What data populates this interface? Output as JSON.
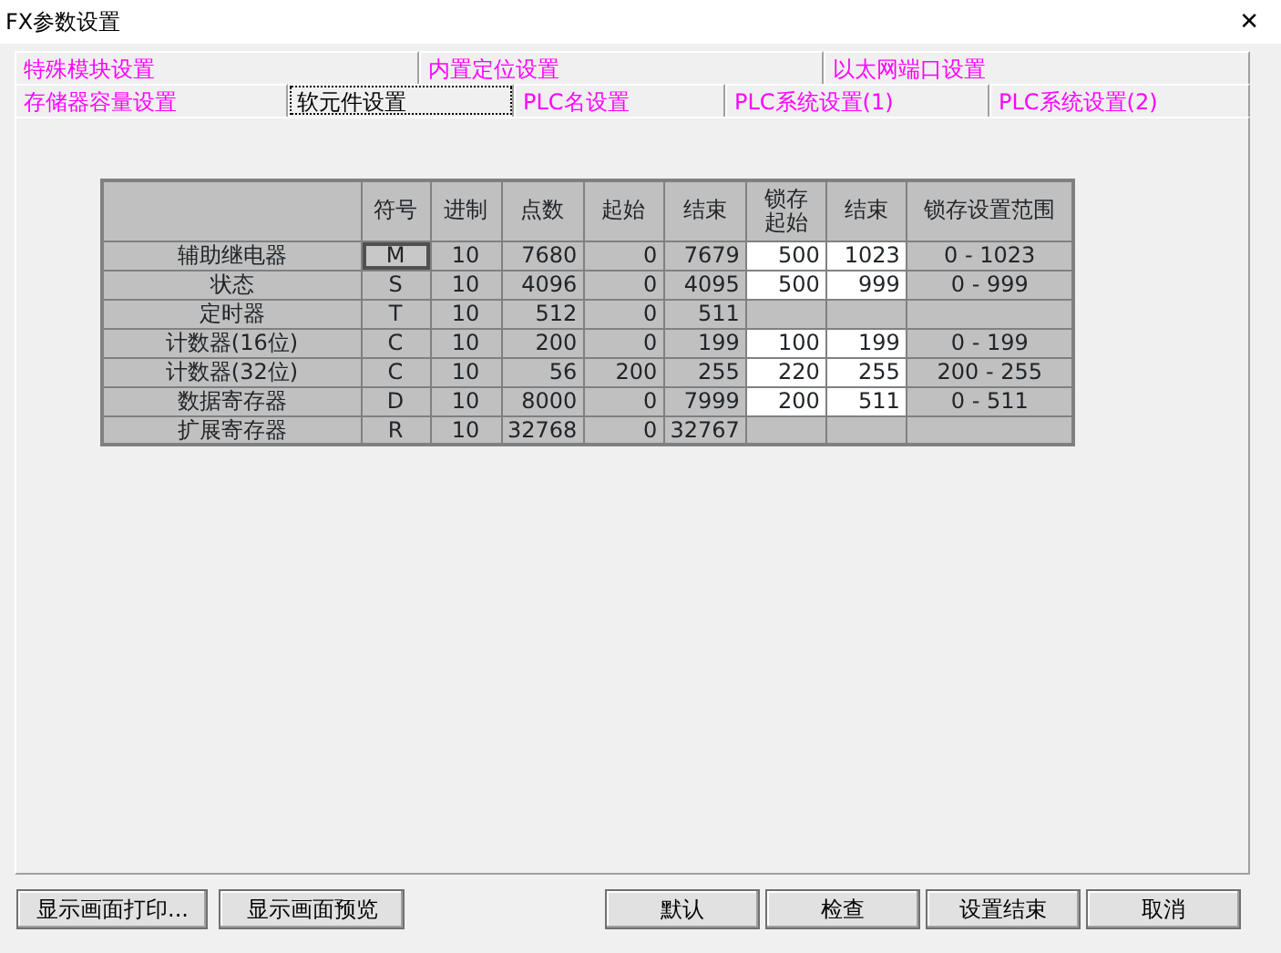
{
  "window": {
    "title": "FX参数设置",
    "close": "✕"
  },
  "tab_rows": [
    [
      {
        "label": "特殊模块设置",
        "selected": false
      },
      {
        "label": "内置定位设置",
        "selected": false
      },
      {
        "label": "以太网端口设置",
        "selected": false
      }
    ],
    [
      {
        "label": "存储器容量设置",
        "selected": false
      },
      {
        "label": "软元件设置",
        "selected": true
      },
      {
        "label": "PLC名设置",
        "selected": false
      },
      {
        "label": "PLC系统设置(1)",
        "selected": false
      },
      {
        "label": "PLC系统设置(2)",
        "selected": false
      }
    ]
  ],
  "table": {
    "columns": [
      "符号",
      "进制",
      "点数",
      "起始",
      "结束",
      "锁存起始",
      "结束",
      "锁存设置范围"
    ],
    "rows": [
      {
        "name": "辅助继电器",
        "symbol": "M",
        "selected": true,
        "base": "10",
        "points": "7680",
        "start": "0",
        "end": "7679",
        "latch_start": "500",
        "latch_end": "1023",
        "latch_range": "0 - 1023"
      },
      {
        "name": "状态",
        "symbol": "S",
        "selected": false,
        "base": "10",
        "points": "4096",
        "start": "0",
        "end": "4095",
        "latch_start": "500",
        "latch_end": "999",
        "latch_range": "0 - 999"
      },
      {
        "name": "定时器",
        "symbol": "T",
        "selected": false,
        "base": "10",
        "points": "512",
        "start": "0",
        "end": "511"
      },
      {
        "name": "计数器(16位)",
        "symbol": "C",
        "selected": false,
        "base": "10",
        "points": "200",
        "start": "0",
        "end": "199",
        "latch_start": "100",
        "latch_end": "199",
        "latch_range": "0 - 199"
      },
      {
        "name": "计数器(32位)",
        "symbol": "C",
        "selected": false,
        "base": "10",
        "points": "56",
        "start": "200",
        "end": "255",
        "latch_start": "220",
        "latch_end": "255",
        "latch_range": "200 - 255"
      },
      {
        "name": "数据寄存器",
        "symbol": "D",
        "selected": false,
        "base": "10",
        "points": "8000",
        "start": "0",
        "end": "7999",
        "latch_start": "200",
        "latch_end": "511",
        "latch_range": "0 - 511"
      },
      {
        "name": "扩展寄存器",
        "symbol": "R",
        "selected": false,
        "base": "10",
        "points": "32768",
        "start": "0",
        "end": "32767"
      }
    ]
  },
  "left_buttons": [
    "显示画面打印...",
    "显示画面预览"
  ],
  "right_buttons": [
    "默认",
    "检查",
    "设置结束",
    "取消"
  ]
}
